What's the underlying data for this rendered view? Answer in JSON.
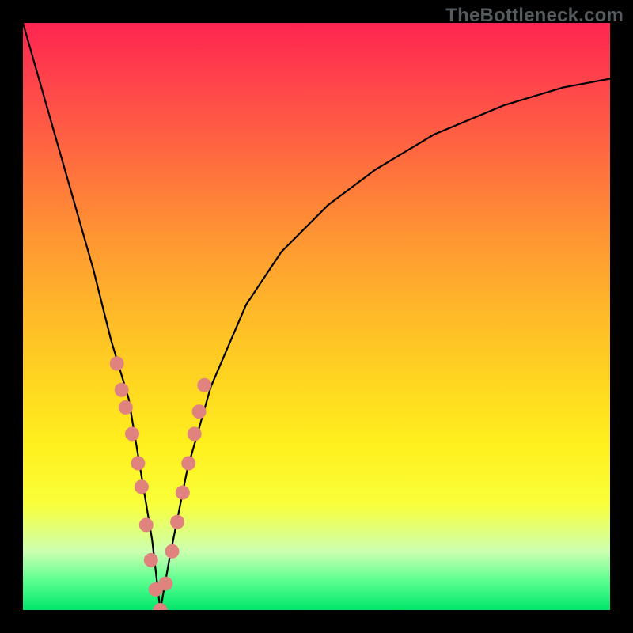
{
  "watermark": "TheBottleneck.com",
  "colors": {
    "page_bg": "#000000",
    "gradient_top": "#ff2551",
    "gradient_bottom": "#00e66a",
    "curve": "#000000",
    "markers": "#e0827e"
  },
  "chart_data": {
    "type": "line",
    "title": "",
    "xlabel": "",
    "ylabel": "",
    "xlim": [
      0,
      100
    ],
    "ylim": [
      0,
      100
    ],
    "series": [
      {
        "name": "curve",
        "x": [
          0,
          4,
          8,
          12,
          15,
          18,
          20,
          22,
          23.4,
          25,
          28,
          32,
          38,
          44,
          52,
          60,
          70,
          82,
          92,
          100
        ],
        "y": [
          100,
          86,
          72,
          58,
          46,
          36,
          24,
          12,
          0,
          9,
          24,
          38,
          52,
          61,
          69,
          75,
          81,
          86,
          89,
          90.5
        ]
      },
      {
        "name": "markers",
        "x": [
          16.0,
          16.8,
          17.5,
          18.6,
          19.6,
          20.2,
          21.0,
          21.8,
          22.6,
          23.4,
          24.3,
          25.4,
          26.3,
          27.2,
          28.2,
          29.2,
          30.0,
          30.9
        ],
        "y": [
          42.0,
          37.5,
          34.5,
          30.0,
          25.0,
          21.0,
          14.5,
          8.5,
          3.5,
          0.0,
          4.5,
          10.0,
          15.0,
          20.0,
          25.0,
          30.0,
          33.8,
          38.3
        ]
      }
    ]
  }
}
